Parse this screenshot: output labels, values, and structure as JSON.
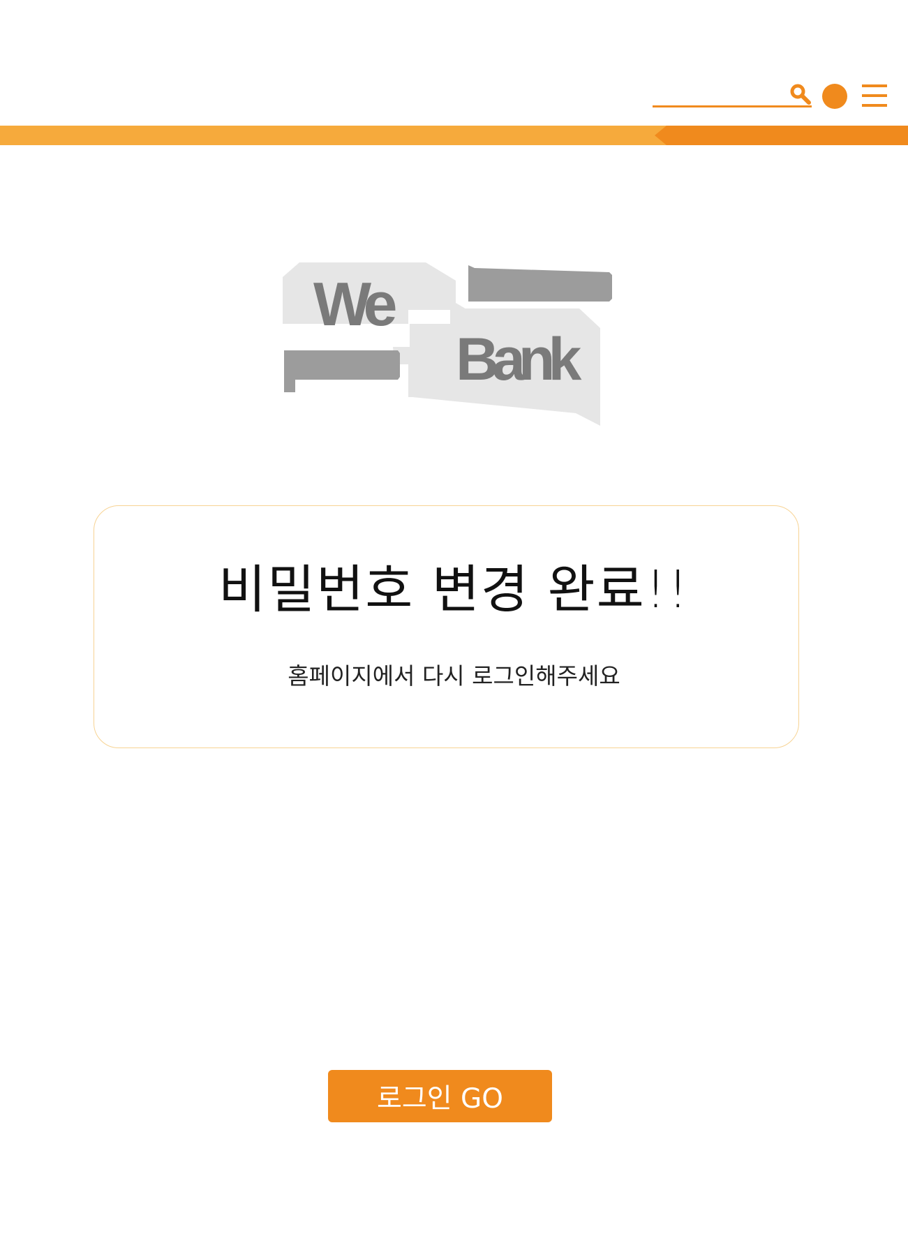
{
  "header": {
    "search": {
      "icon": "search-icon"
    },
    "profile": {
      "icon": "circle-icon"
    },
    "menu": {
      "icon": "hamburger-menu-icon"
    }
  },
  "logo": {
    "word1": "We",
    "word2": "Bank"
  },
  "card": {
    "title": "비밀번호 변경 완료!!",
    "subtitle": "홈페이지에서 다시 로그인해주세요"
  },
  "login_button": {
    "label": "로그인 GO"
  },
  "colors": {
    "accent": "#f08a1d",
    "accent_light": "#f6aa3c",
    "card_border": "#f7d393",
    "logo_bg": "#e6e6e6",
    "logo_mid": "#9c9c9c",
    "logo_dark": "#7a7a7a"
  }
}
